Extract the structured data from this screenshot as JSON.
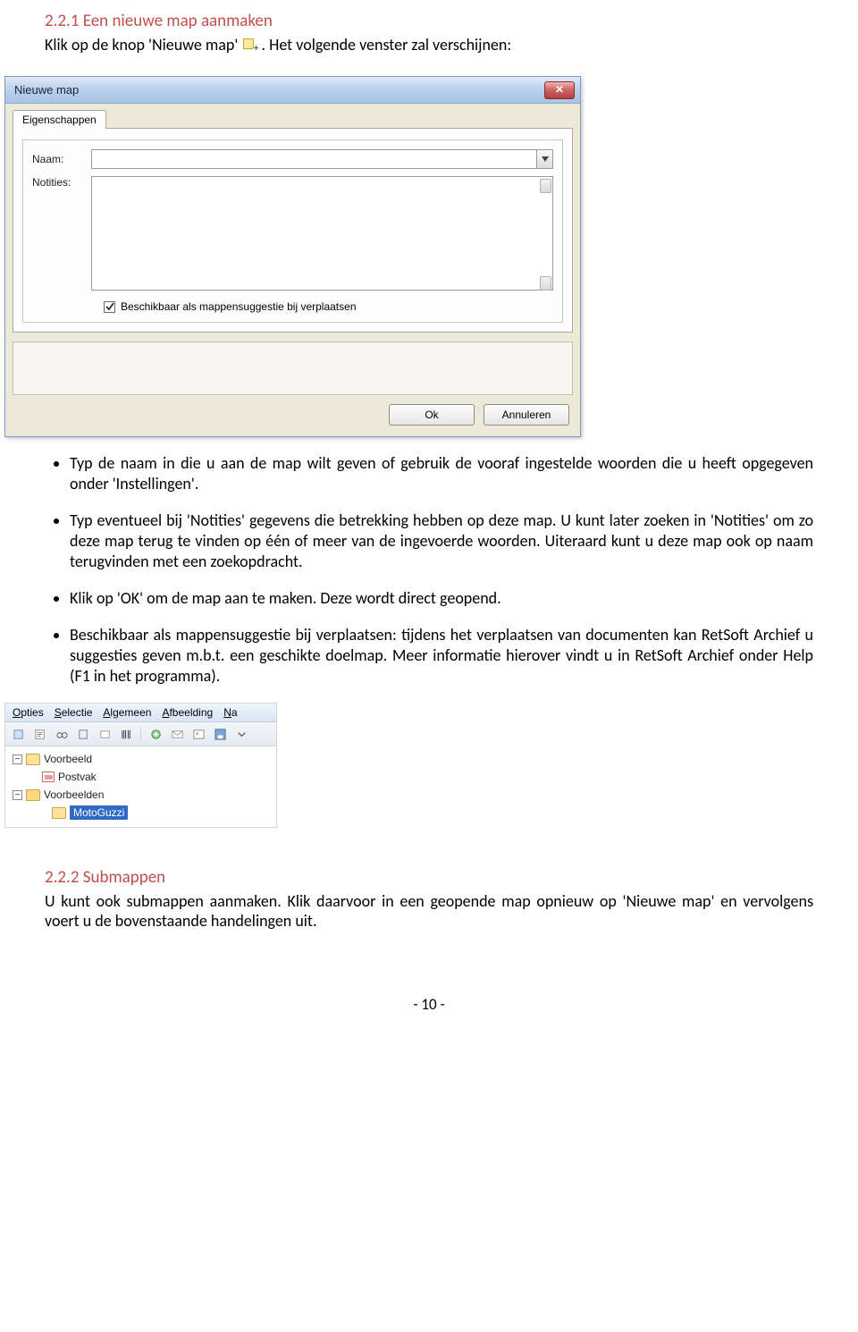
{
  "section1": {
    "heading": "2.2.1 Een nieuwe map aanmaken",
    "intro_prefix": "Klik op de knop 'Nieuwe map' ",
    "intro_suffix": ". Het volgende venster zal verschijnen:"
  },
  "dialog": {
    "title": "Nieuwe map",
    "tab": "Eigenschappen",
    "naam_label": "Naam:",
    "naam_value": "",
    "notities_label": "Notities:",
    "notities_value": "",
    "checkbox_label": "Beschikbaar als mappensuggestie bij verplaatsen",
    "checkbox_checked": true,
    "ok_label": "Ok",
    "cancel_label": "Annuleren"
  },
  "bullets": [
    "Typ de naam in die u aan de map wilt geven of gebruik de vooraf ingestelde woorden die u heeft opgegeven onder 'Instellingen'.",
    "Typ eventueel bij 'Notities' gegevens die betrekking hebben op deze map. U kunt later zoeken in 'Notities' om zo deze map terug te vinden op één of meer van de ingevoerde woorden. Uiteraard kunt u deze map ook op naam terugvinden met een zoekopdracht.",
    "Klik op 'OK' om de map aan te maken. Deze wordt direct geopend.",
    "Beschikbaar als mappensuggestie bij verplaatsen: tijdens het verplaatsen van documenten kan RetSoft Archief u suggesties geven m.b.t. een geschikte doelmap. Meer informatie hierover vindt u in RetSoft Archief onder Help (F1 in het programma)."
  ],
  "tree": {
    "menus": [
      "Opties",
      "Selectie",
      "Algemeen",
      "Afbeelding",
      "Na"
    ],
    "items": [
      {
        "label": "Voorbeeld",
        "icon": "folder",
        "level": 0,
        "expander": "−"
      },
      {
        "label": "Postvak",
        "icon": "inbox",
        "level": 1,
        "expander": ""
      },
      {
        "label": "Voorbeelden",
        "icon": "folder-open",
        "level": 0,
        "expander": "−"
      },
      {
        "label": "MotoGuzzi",
        "icon": "folder",
        "level": 2,
        "expander": "",
        "selected": true
      }
    ]
  },
  "section2": {
    "heading": "2.2.2 Submappen",
    "body": "U kunt ook submappen aanmaken. Klik daarvoor in een geopende map opnieuw op 'Nieuwe map' en vervolgens voert u de bovenstaande handelingen uit."
  },
  "page_number": "- 10 -"
}
